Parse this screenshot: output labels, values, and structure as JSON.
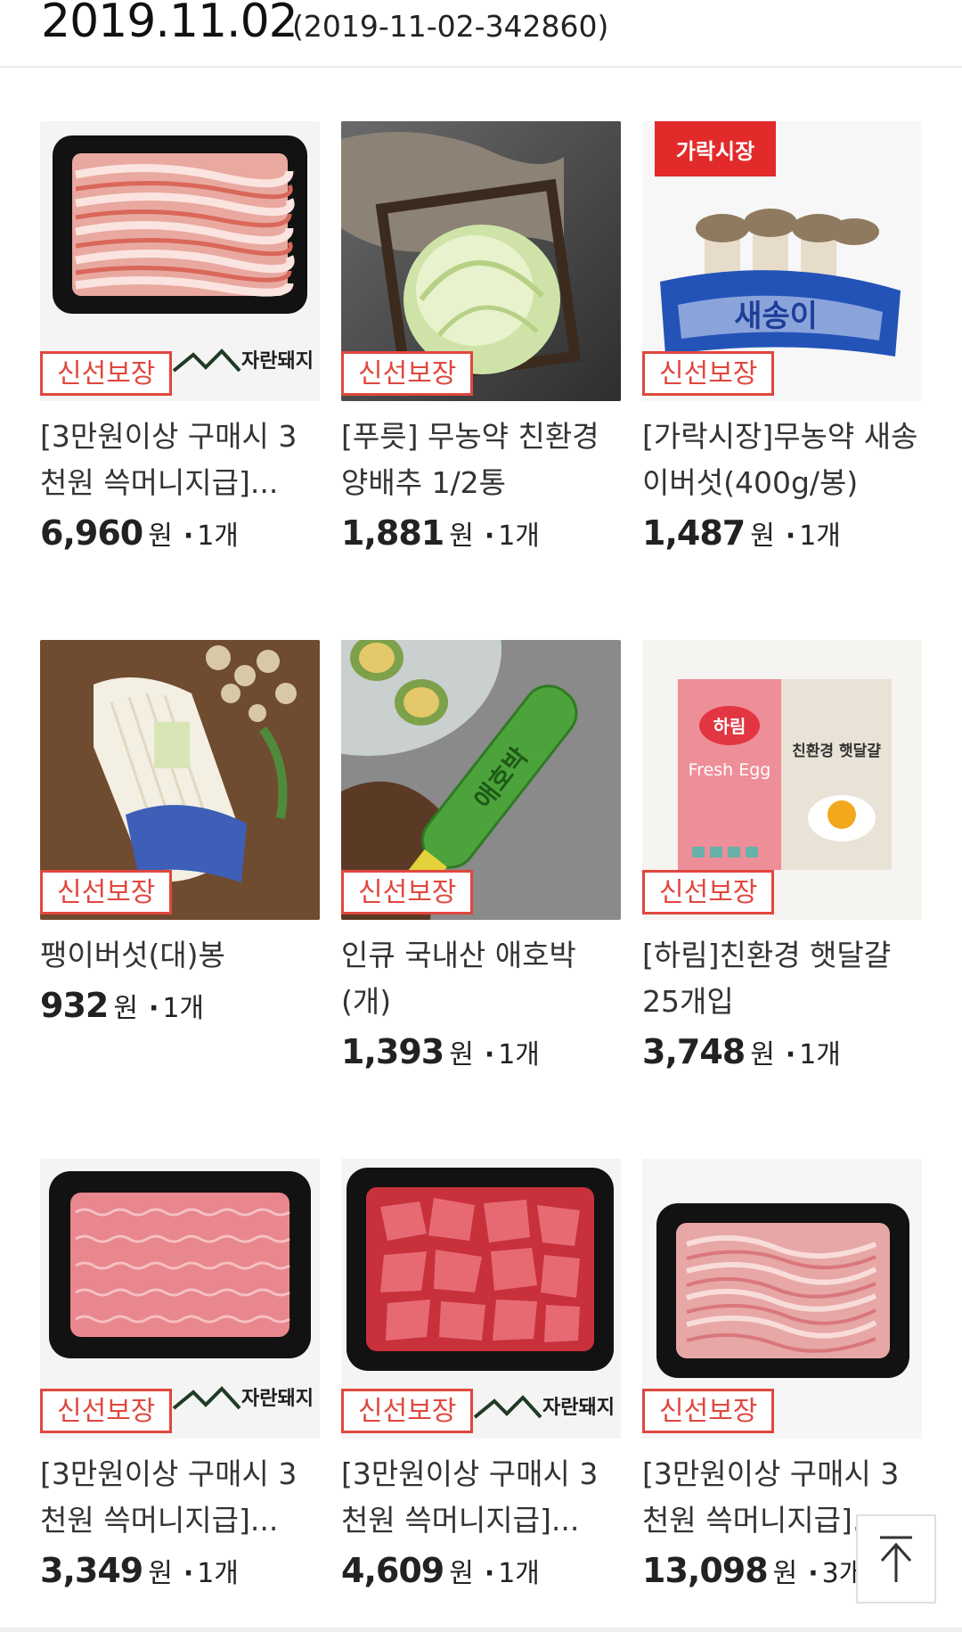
{
  "header": {
    "date": "2019.11.02",
    "order_id": "(2019-11-02-342860)"
  },
  "badge_label": "신선보장",
  "colors": {
    "badge": "#e0473e"
  },
  "products": [
    {
      "name": "[3만원이상 구매시 3천원 쓱머니지급]...",
      "price": "6,960",
      "unit": "원",
      "qty": "1개",
      "image": "pork-belly-tray",
      "logo": "자란돼지"
    },
    {
      "name": "[푸릇] 무농약 친환경 양배추 1/2통",
      "price": "1,881",
      "unit": "원",
      "qty": "1개",
      "image": "cabbage"
    },
    {
      "name": "[가락시장]무농약 새송이버섯(400g/봉)",
      "price": "1,487",
      "unit": "원",
      "qty": "1개",
      "image": "king-oyster-mushroom",
      "tag": "가락시장",
      "bag_text": "새송이"
    },
    {
      "name": "팽이버섯(대)봉",
      "price": "932",
      "unit": "원",
      "qty": "1개",
      "image": "enoki-mushroom"
    },
    {
      "name": "인큐 국내산 애호박(개)",
      "price": "1,393",
      "unit": "원",
      "qty": "1개",
      "image": "zucchini",
      "bag_text": "애호박"
    },
    {
      "name": "[하림]친환경 햇달걀 25개입",
      "price": "3,748",
      "unit": "원",
      "qty": "1개",
      "image": "egg-carton",
      "brand": "하림",
      "box_title": "Fresh Egg",
      "box_text": "친환경 햇달걀"
    },
    {
      "name": "[3만원이상 구매시 3천원 쓱머니지급]...",
      "price": "3,349",
      "unit": "원",
      "qty": "1개",
      "image": "ground-pork-tray",
      "logo": "자란돼지"
    },
    {
      "name": "[3만원이상 구매시 3천원 쓱머니지급]...",
      "price": "4,609",
      "unit": "원",
      "qty": "1개",
      "image": "pork-chunks-tray",
      "logo": "자란돼지"
    },
    {
      "name": "[3만원이상 구매시 3천원 쓱머니지급]...",
      "price": "13,098",
      "unit": "원",
      "qty": "3개",
      "image": "pork-slices-tray"
    }
  ]
}
